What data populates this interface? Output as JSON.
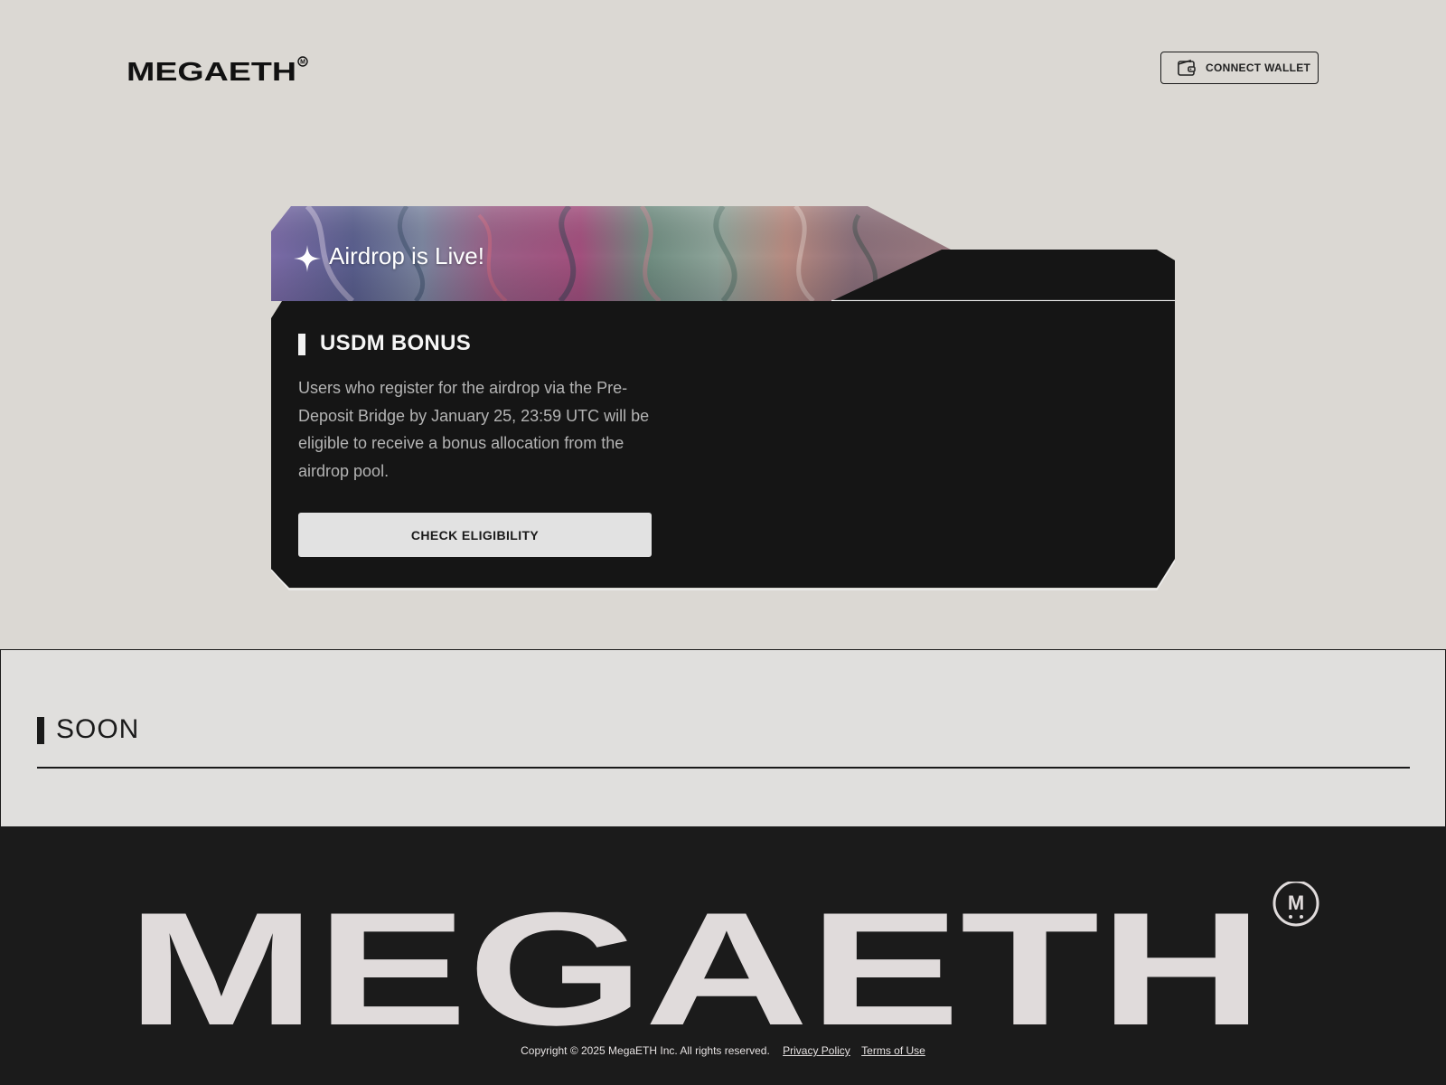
{
  "header": {
    "logo_text": "MEGAETH",
    "connect_wallet_label": "CONNECT WALLET"
  },
  "card": {
    "banner_title": "Airdrop is Live!",
    "bonus_title": "USDM BONUS",
    "bonus_description": "Users who register for the airdrop via the Pre-Deposit Bridge by January 25, 23:59 UTC will be eligible to receive a bonus allocation from the airdrop pool.",
    "check_eligibility_label": "CHECK ELIGIBILITY"
  },
  "soon": {
    "title": "SOON"
  },
  "footer": {
    "logo_text": "MEGAETH",
    "copyright": "Copyright © 2025 MegaETH Inc. All rights reserved.",
    "privacy_label": "Privacy Policy",
    "terms_label": "Terms of Use"
  },
  "colors": {
    "page_bg": "#dbd8d3",
    "card_bg": "#151515",
    "footer_bg": "#1b1b1b",
    "logo_light": "#e0dbdb"
  }
}
